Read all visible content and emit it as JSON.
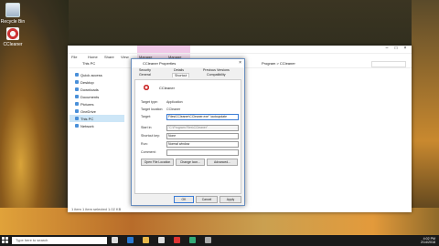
{
  "desktop": {
    "icons": [
      {
        "label": "Recycle Bin"
      },
      {
        "label": "CCleaner"
      }
    ]
  },
  "explorer": {
    "ribbon_tabs": [
      "File",
      "Home",
      "Share",
      "View",
      "Shortcut Tools",
      "CCleaner"
    ],
    "ribbon_sub": [
      "Manage",
      "Manage"
    ],
    "address_left": "This PC",
    "address_right": "Program > CCleaner",
    "nav": [
      "Quick access",
      "Desktop",
      "Downloads",
      "Documents",
      "Pictures",
      "OneDrive",
      "This PC",
      "Network"
    ],
    "status": "1 item   1 item selected   1.02 KB"
  },
  "dialog": {
    "title": "CCleaner Properties",
    "close": "×",
    "tabs_row1": [
      "Security",
      "Details",
      "Previous Versions"
    ],
    "tabs_row2": [
      "General",
      "Shortcut",
      "Compatibility"
    ],
    "app_name": "CCleaner",
    "fields": {
      "target_type_label": "Target type:",
      "target_type": "Application",
      "target_location_label": "Target location:",
      "target_location": "CCleaner",
      "target_label": "Target:",
      "target": "Files\\CCleaner\\CCleaner.exe\" /autoupdate",
      "start_in_label": "Start in:",
      "start_in": "\"C:\\Program Files\\CCleaner\"",
      "shortcut_key_label": "Shortcut key:",
      "shortcut_key": "None",
      "run_label": "Run:",
      "run": "Normal window",
      "comment_label": "Comment:",
      "comment": ""
    },
    "buttons": {
      "open_location": "Open File Location",
      "change_icon": "Change Icon...",
      "advanced": "Advanced...",
      "ok": "OK",
      "cancel": "Cancel",
      "apply": "Apply"
    }
  },
  "taskbar": {
    "search_placeholder": "Type here to search",
    "time": "4:02 PM",
    "date": "2/14/2018"
  }
}
